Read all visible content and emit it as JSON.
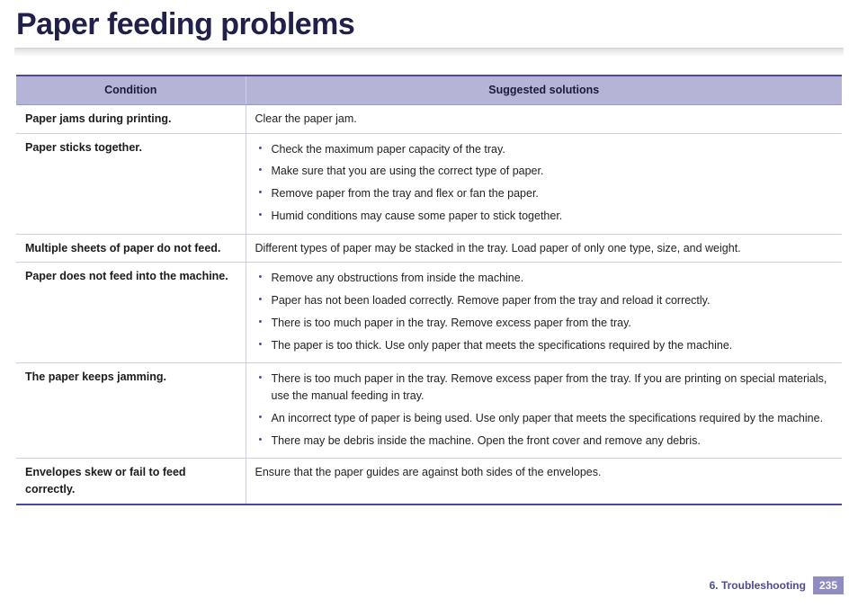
{
  "title": "Paper feeding problems",
  "headers": {
    "condition": "Condition",
    "solutions": "Suggested solutions"
  },
  "rows": [
    {
      "condition": "Paper jams during printing.",
      "type": "text",
      "text": "Clear the paper jam."
    },
    {
      "condition": "Paper sticks together.",
      "type": "list",
      "items": [
        "Check the maximum paper capacity of the tray.",
        "Make sure that you are using the correct type of paper.",
        "Remove paper from the tray and flex or fan the paper.",
        "Humid conditions may cause some paper to stick together."
      ]
    },
    {
      "condition": "Multiple sheets of paper do not feed.",
      "type": "text",
      "text": "Different types of paper may be stacked in the tray. Load paper of only one type, size, and weight."
    },
    {
      "condition": "Paper does not feed into the machine.",
      "type": "list",
      "items": [
        "Remove any obstructions from inside the machine.",
        "Paper has not been loaded correctly. Remove paper from the tray and reload it correctly.",
        "There is too much paper in the tray. Remove excess paper from the tray.",
        "The paper is too thick. Use only paper that meets the specifications required by the machine."
      ]
    },
    {
      "condition": "The paper keeps jamming.",
      "type": "list",
      "items": [
        "There is too much paper in the tray. Remove excess paper from the tray. If you are printing on special materials, use the manual feeding in tray.",
        "An incorrect type of paper is being used. Use only paper that meets the specifications required by the machine.",
        "There may be debris inside the machine. Open the front cover and remove any debris."
      ]
    },
    {
      "condition": "Envelopes skew or fail to feed correctly.",
      "type": "text",
      "text": "Ensure that the paper guides are against both sides of the envelopes."
    }
  ],
  "footer": {
    "chapter": "6.  Troubleshooting",
    "page": "235"
  }
}
